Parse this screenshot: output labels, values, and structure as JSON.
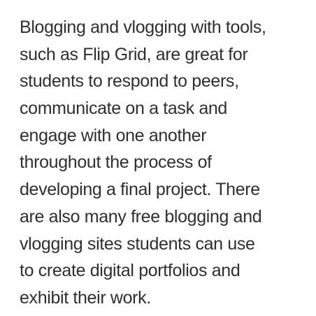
{
  "paragraph": {
    "lines": [
      "Blogging and vlogging with tools,",
      "such as Flip Grid, are great for",
      "students to respond to peers,",
      "communicate on a task and",
      "engage with one another",
      "throughout the process of",
      "developing a final project. There",
      "are also many free blogging and",
      "vlogging sites students can use",
      "to create digital portfolios and",
      "exhibit their work."
    ]
  }
}
